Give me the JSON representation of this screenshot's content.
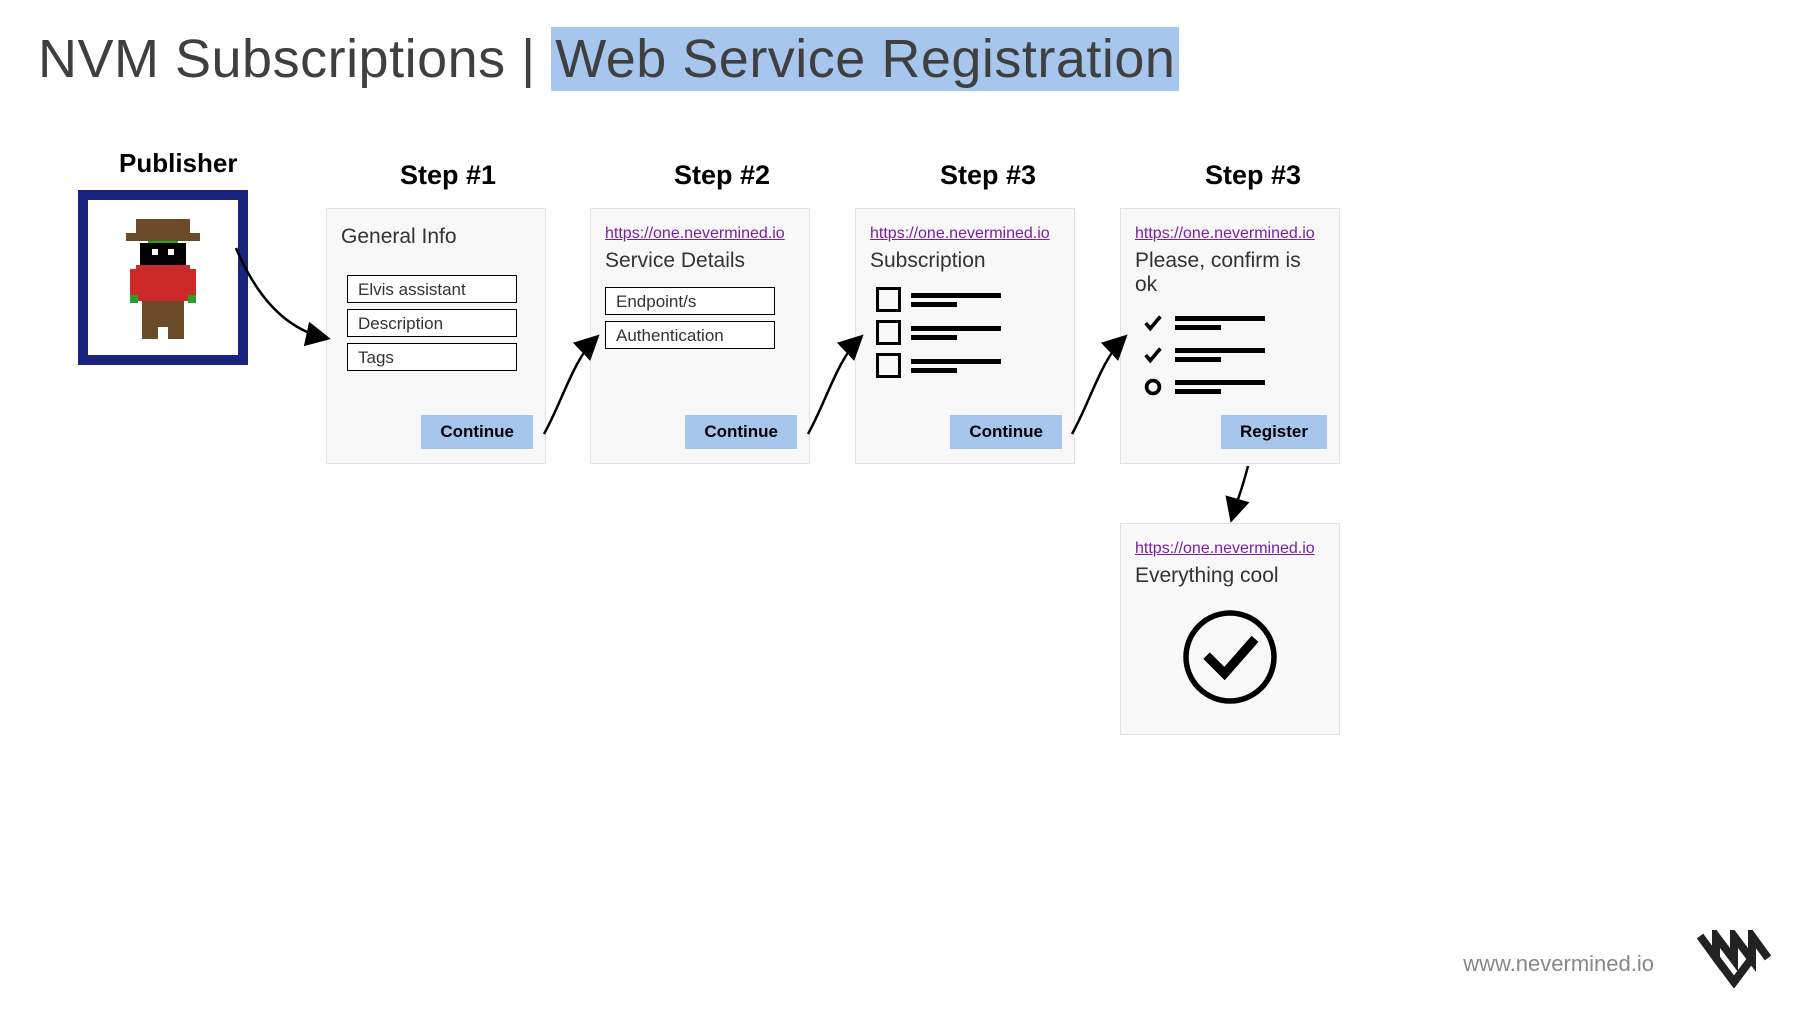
{
  "title": {
    "prefix": "NVM Subscriptions | ",
    "highlight": "Web Service Registration"
  },
  "publisher": {
    "label": "Publisher"
  },
  "steps": {
    "s1": {
      "label": "Step #1"
    },
    "s2": {
      "label": "Step #2"
    },
    "s3": {
      "label": "Step #3"
    },
    "s4": {
      "label": "Step #3"
    }
  },
  "card1": {
    "heading": "General Info",
    "fields": [
      "Elvis assistant",
      "Description",
      "Tags"
    ],
    "button": "Continue"
  },
  "card2": {
    "url": "https://one.nevermined.io",
    "heading": "Service Details",
    "fields": [
      "Endpoint/s",
      "Authentication"
    ],
    "button": "Continue"
  },
  "card3": {
    "url": "https://one.nevermined.io",
    "heading": "Subscription",
    "button": "Continue"
  },
  "card4": {
    "url": "https://one.nevermined.io",
    "heading": "Please, confirm is ok",
    "button": "Register"
  },
  "card5": {
    "url": "https://one.nevermined.io",
    "heading": "Everything cool"
  },
  "footer": {
    "url": "www.nevermined.io"
  }
}
